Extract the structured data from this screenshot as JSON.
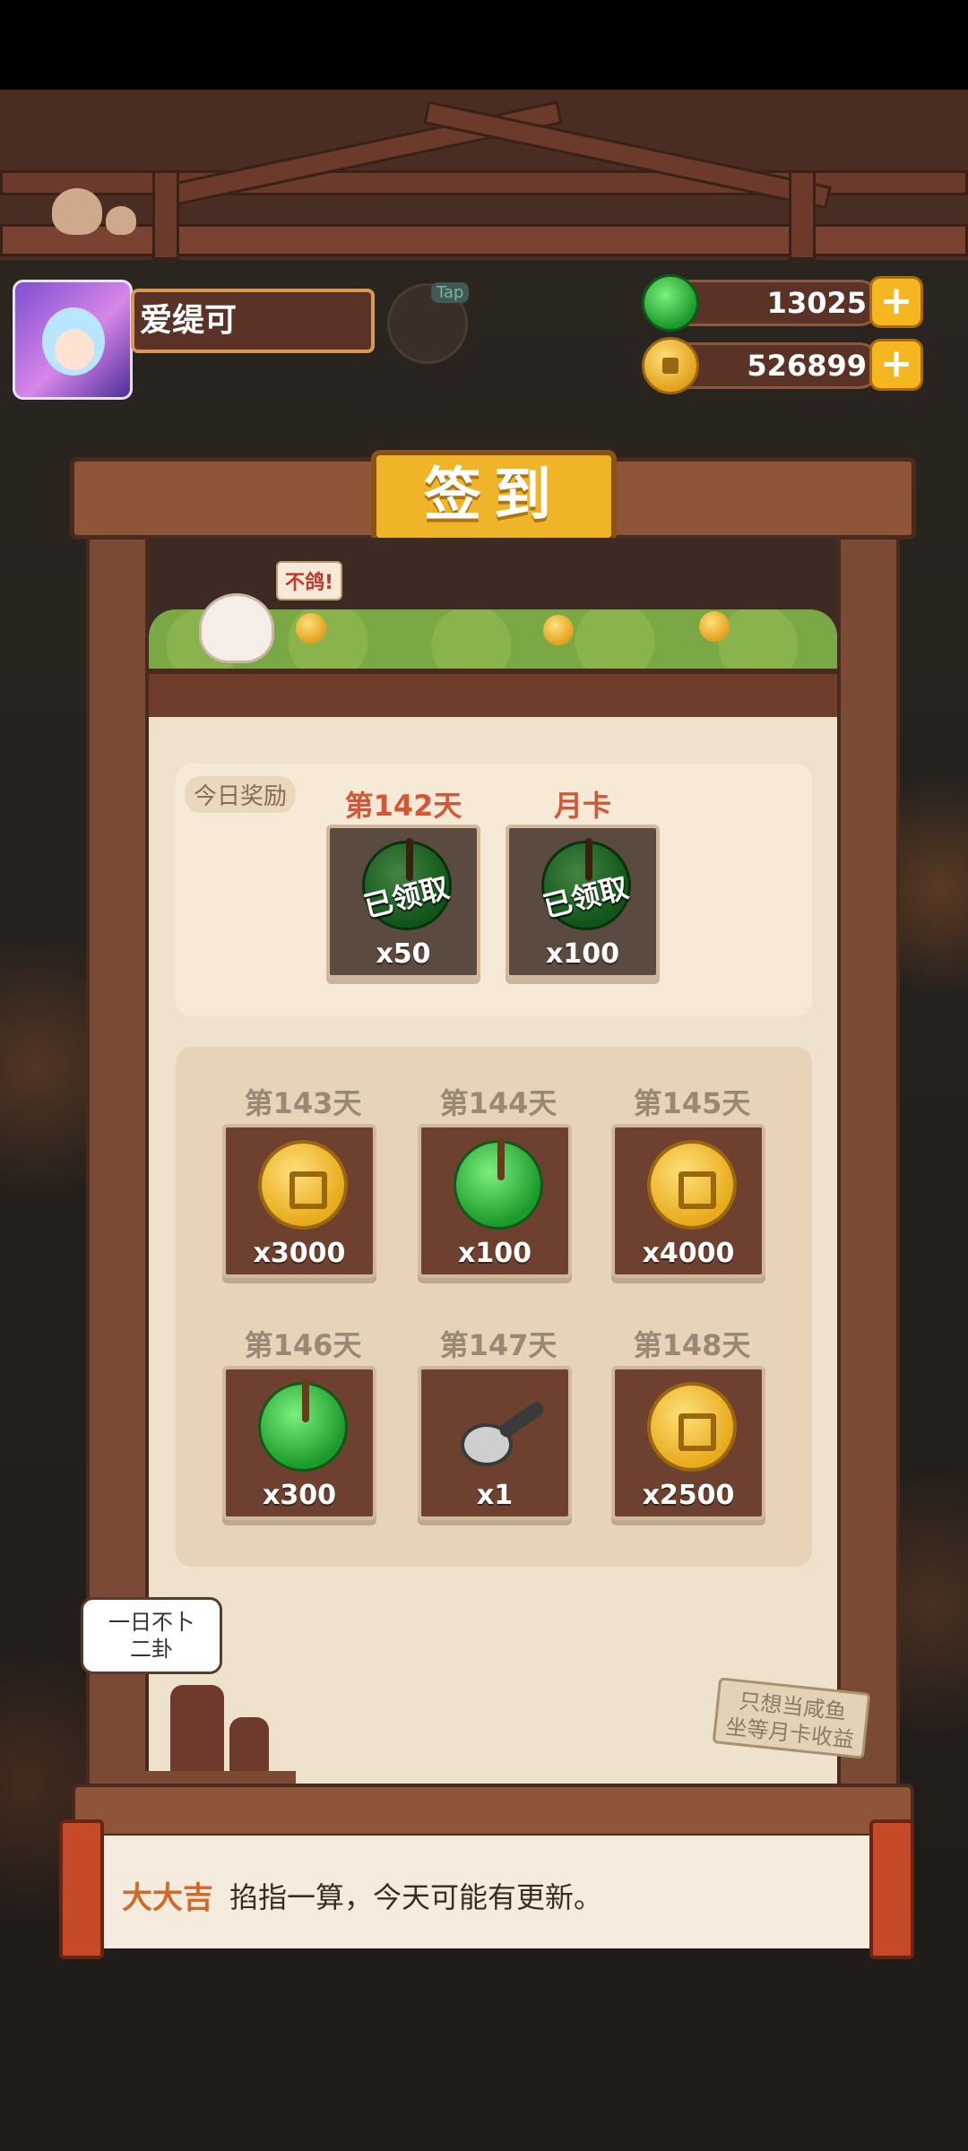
{
  "player": {
    "name": "爱缇可",
    "tap_label": "Tap"
  },
  "resources": {
    "jade": "13025",
    "coins": "526899",
    "plus": "+"
  },
  "signin": {
    "title": "签到",
    "garden_bubble": "不鸽!",
    "today_label": "今日奖励",
    "today": [
      {
        "day": "第142天",
        "qty": "x50",
        "status": "已领取",
        "icon": "jade-icon"
      },
      {
        "day": "月卡",
        "qty": "x100",
        "status": "已领取",
        "icon": "jade-icon"
      }
    ],
    "upcoming": [
      {
        "day": "第143天",
        "qty": "x3000",
        "icon": "coin-icon"
      },
      {
        "day": "第144天",
        "qty": "x100",
        "icon": "jade-icon"
      },
      {
        "day": "第145天",
        "qty": "x4000",
        "icon": "coin-icon"
      },
      {
        "day": "第146天",
        "qty": "x300",
        "icon": "jade-icon"
      },
      {
        "day": "第147天",
        "qty": "x1",
        "icon": "ladle-icon"
      },
      {
        "day": "第148天",
        "qty": "x2500",
        "icon": "coin-icon"
      }
    ],
    "speech_line1": "一日不卜",
    "speech_line2": "二卦",
    "sign_line1": "只想当咸鱼",
    "sign_line2": "坐等月卡收益"
  },
  "fortune": {
    "level": "大大吉",
    "text": "掐指一算，今天可能有更新。"
  },
  "colors": {
    "accent_gold": "#f0b429",
    "wood": "#8e5538",
    "fortune_orange": "#d06a2a",
    "day_red": "#d2573a"
  }
}
